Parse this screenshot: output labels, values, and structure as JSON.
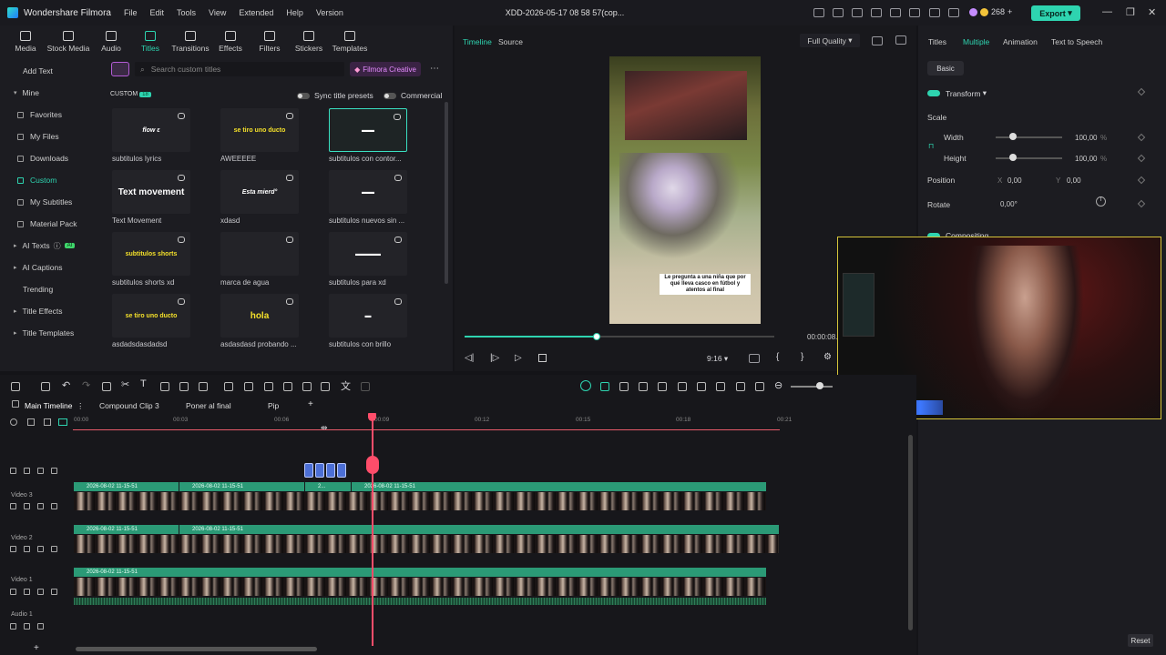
{
  "app": {
    "name": "Wondershare Filmora",
    "project_title": "XDD-2026-05-17 08 58 57(cop...",
    "credits": "268"
  },
  "menu": [
    "File",
    "Edit",
    "Tools",
    "View",
    "Extended",
    "Help",
    "Version"
  ],
  "export_label": "Export",
  "toolbar": [
    "Media",
    "Stock Media",
    "Audio",
    "Titles",
    "Transitions",
    "Effects",
    "Filters",
    "Stickers",
    "Templates"
  ],
  "sidebar": {
    "add_text": "Add Text",
    "mine": "Mine",
    "items": [
      "Favorites",
      "My Files",
      "Downloads",
      "Custom",
      "My Subtitles",
      "Material Pack"
    ],
    "ai_texts": "AI Texts",
    "ai_badge": "AI",
    "ai_captions": "AI Captions",
    "trending": "Trending",
    "title_effects": "Title Effects",
    "title_templates": "Title Templates"
  },
  "search": {
    "placeholder": "Search custom titles",
    "creative": "Filmora Creative"
  },
  "custom_header": {
    "label": "CUSTOM",
    "count": "18",
    "sync": "Sync title presets",
    "commercial": "Commercial"
  },
  "cards": [
    {
      "thumb": "flow ε",
      "label": "subtitulos lyrics",
      "color": "#ffffff"
    },
    {
      "thumb": "se tiro uno ducto",
      "label": "AWEEEEE",
      "color": "#f4e02a"
    },
    {
      "thumb": "▬▬",
      "label": "subtitulos con contor...",
      "color": "#ffffff"
    },
    {
      "thumb": "Text movement",
      "label": "Text Movement",
      "color": "#ffffff"
    },
    {
      "thumb": "Esta mierd°",
      "label": "xdasd",
      "color": "#ffffff"
    },
    {
      "thumb": "▬▬",
      "label": "subtitulos nuevos sin ...",
      "color": "#ffffff"
    },
    {
      "thumb": "subtitulos shorts",
      "label": "subtitulos shorts xd",
      "color": "#f4e02a"
    },
    {
      "thumb": "",
      "label": "marca de agua",
      "color": "#ffffff"
    },
    {
      "thumb": "▬▬▬▬",
      "label": "subtitulos para xd",
      "color": "#ffffff"
    },
    {
      "thumb": "se tiro uno ducto",
      "label": "asdadsdasdadsd",
      "color": "#f4e02a"
    },
    {
      "thumb": "hola",
      "label": "asdasdasd probando ...",
      "color": "#f4e02a"
    },
    {
      "thumb": "▬",
      "label": "subtitulos con brillo",
      "color": "#ffffff"
    }
  ],
  "preview": {
    "tab_timeline": "Timeline",
    "tab_source": "Source",
    "quality": "Full Quality",
    "caption": "Le pregunta a una niña que por qué lleva casco en fútbol y atentos al final",
    "ratio": "9:16",
    "timecode": "00:00:08.",
    "progress": 0.43
  },
  "inspector": {
    "tabs": [
      "Titles",
      "Multiple",
      "Animation",
      "Text to Speech"
    ],
    "basic": "Basic",
    "transform": "Transform",
    "scale": "Scale",
    "width": "Width",
    "width_val": "100,00",
    "height": "Height",
    "height_val": "100,00",
    "unit": "%",
    "position": "Position",
    "pos_x_label": "X",
    "pos_x": "0,00",
    "pos_y_label": "Y",
    "pos_y": "0,00",
    "rotate": "Rotate",
    "rotate_val": "0,00°",
    "compositing": "Compositing",
    "reset": "Reset"
  },
  "timeline": {
    "tabs": [
      "Main Timeline",
      "Compound Clip 3",
      "Poner al final",
      "Pip"
    ],
    "ticks": [
      "00:00",
      "00:03",
      "00:06",
      "00:09",
      "00:12",
      "00:15",
      "00:18",
      "00:21"
    ],
    "tracks": {
      "video3": "Video 3",
      "video2": "Video 2",
      "video1": "Video 1",
      "audio1": "Audio 1"
    },
    "clips_v3": [
      "2026-08-02 11-15-51",
      "2026-08-02 11-15-51",
      "2...",
      "2026-08-02 11-15-51"
    ],
    "clips_v2": [
      "2026-08-02 11-15-51",
      "2026-08-02 11-15-51"
    ],
    "clips_v1": [
      "2026-08-02 11-15-51"
    ]
  },
  "colors": {
    "accent": "#2ed4b0",
    "playhead": "#ff4d6a",
    "clip": "#2b9a76"
  }
}
